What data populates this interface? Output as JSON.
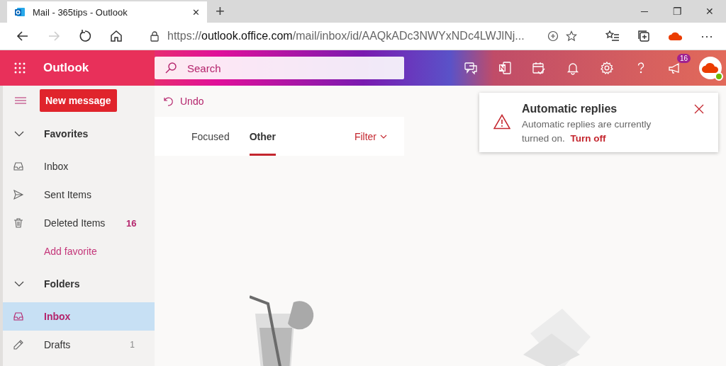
{
  "browser": {
    "tab_title": "Mail - 365tips - Outlook",
    "tab_close": "✕",
    "new_tab": "+",
    "url_scheme": "https://",
    "url_host": "outlook.office.com",
    "url_path": "/mail/inbox/id/AAQkADc3NWYxNDc4LWJlNj...",
    "window_buttons": [
      "─",
      "❐",
      "✕"
    ],
    "menu": "···"
  },
  "header": {
    "app_name": "Outlook",
    "search": {
      "placeholder": "Search"
    },
    "icons": [
      {
        "kind": "chat"
      },
      {
        "kind": "onenote"
      },
      {
        "kind": "todo"
      },
      {
        "kind": "bell"
      },
      {
        "kind": "gear"
      },
      {
        "kind": "help"
      },
      {
        "kind": "megaphone",
        "badge": "16"
      }
    ],
    "avatar": {
      "online": true
    }
  },
  "sidebar": {
    "new_message": "New message",
    "sections": [
      {
        "title": "Favorites",
        "expanded": true,
        "items": [
          {
            "kind": "inbox",
            "label": "Inbox",
            "selected": false
          },
          {
            "kind": "send",
            "label": "Sent Items",
            "selected": false
          },
          {
            "kind": "trash",
            "label": "Deleted Items",
            "selected": false,
            "count": "16",
            "unread": true
          }
        ],
        "link": "Add favorite"
      },
      {
        "title": "Folders",
        "expanded": true,
        "items": [
          {
            "kind": "inbox",
            "label": "Inbox",
            "selected": true
          },
          {
            "kind": "pencil",
            "label": "Drafts",
            "selected": false,
            "count": "1",
            "unread": false
          }
        ]
      }
    ]
  },
  "toolbar": {
    "undo": "Undo"
  },
  "message_list": {
    "tabs": [
      {
        "label": "Focused",
        "selected": false
      },
      {
        "label": "Other",
        "selected": true
      }
    ],
    "filter": "Filter"
  },
  "toast": {
    "title": "Automatic replies",
    "message": "Automatic replies are currently turned on.",
    "action": "Turn off"
  }
}
